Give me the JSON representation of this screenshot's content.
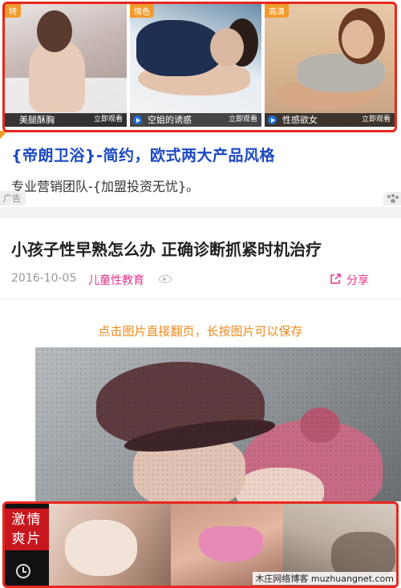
{
  "top_ad": {
    "tiles": [
      {
        "tag": "特",
        "title": "美腿酥胸",
        "action": "立即观看"
      },
      {
        "tag": "情色",
        "title": "空姐的诱惑",
        "action": "立即观看"
      },
      {
        "tag": "高清",
        "title": "性感欲女",
        "action": "立即观看"
      }
    ]
  },
  "text_ad": {
    "headline": "{帝朗卫浴}-简约，欧式两大产品风格",
    "description": "专业营销团队-{加盟投资无忧}。",
    "ad_label": "广告",
    "accent_color": "#1c49c2"
  },
  "article": {
    "title": "小孩子性早熟怎么办 正确诊断抓紧时机治疗",
    "date": "2016-10-05",
    "channel": "儿童性教育",
    "share_label": "分享",
    "hint": "点击图片直接翻页，长按图片可以保存",
    "channel_color": "#e0338c",
    "hint_color": "#f08a1c"
  },
  "bottom_ad": {
    "label_line1": "激情",
    "label_line2": "爽片",
    "clock_icon": "clock-icon"
  },
  "watermark": "木庄网络博客 muzhuangnet.com",
  "colors": {
    "ad_frame": "#e8281e",
    "tag": "#f29b2b"
  }
}
